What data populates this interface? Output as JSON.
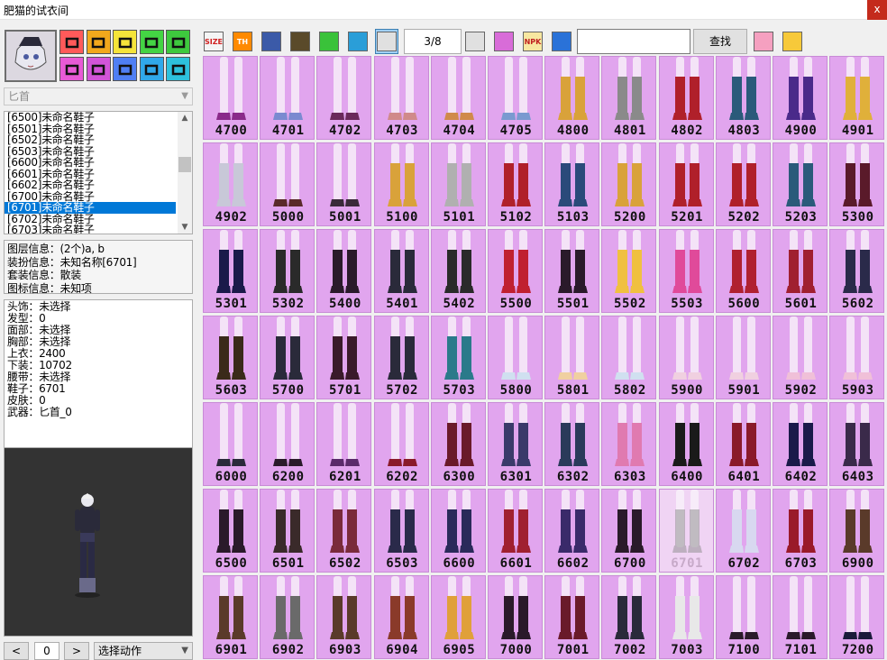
{
  "window": {
    "title": "肥猫的试衣间",
    "close_label": "x"
  },
  "category_buttons": [
    {
      "icon": "cat-ears-icon",
      "color": "#ff5a5a"
    },
    {
      "icon": "hair-icon",
      "color": "#f2a81c"
    },
    {
      "icon": "eyes-icon",
      "color": "#f5e43a"
    },
    {
      "icon": "wings-icon",
      "color": "#44d444"
    },
    {
      "icon": "crown-icon",
      "color": "#3ec93e"
    },
    {
      "icon": "gate-icon",
      "color": "#e85ad6"
    },
    {
      "icon": "belt-icon",
      "color": "#d254d8"
    },
    {
      "icon": "shoes-icon",
      "color": "#4f7ff4"
    },
    {
      "icon": "figure-icon",
      "color": "#30a8ea"
    },
    {
      "icon": "cross-icon",
      "color": "#2dc1dc"
    }
  ],
  "weapon_dropdown": {
    "value": "匕首"
  },
  "item_list": [
    {
      "label": "[6500]未命名鞋子",
      "selected": false
    },
    {
      "label": "[6501]未命名鞋子",
      "selected": false
    },
    {
      "label": "[6502]未命名鞋子",
      "selected": false
    },
    {
      "label": "[6503]未命名鞋子",
      "selected": false
    },
    {
      "label": "[6600]未命名鞋子",
      "selected": false
    },
    {
      "label": "[6601]未命名鞋子",
      "selected": false
    },
    {
      "label": "[6602]未命名鞋子",
      "selected": false
    },
    {
      "label": "[6700]未命名鞋子",
      "selected": false
    },
    {
      "label": "[6701]未命名鞋子",
      "selected": true
    },
    {
      "label": "[6702]未命名鞋子",
      "selected": false
    },
    {
      "label": "[6703]未命名鞋子",
      "selected": false
    }
  ],
  "info": {
    "layer": "图层信息：(2个)a, b",
    "costume": "装扮信息：未知名称[6701]",
    "set": "套装信息：散装",
    "icon": "图标信息：未知项"
  },
  "stats": [
    "头饰：未选择",
    "发型：0",
    "面部：未选择",
    "胸部：未选择",
    "上衣：2400",
    "下装：10702",
    "腰带：未选择",
    "鞋子：6701",
    "皮肤：0",
    "武器：匕首_0"
  ],
  "bottom": {
    "prev": "<",
    "index": "0",
    "next": ">",
    "action": "选择动作"
  },
  "toolbar": {
    "buttons": [
      {
        "icon": "size-icon",
        "text": "SIZE",
        "bg": "#f4f4f4",
        "fg": "#d02020"
      },
      {
        "icon": "th-icon",
        "text": "TH",
        "bg": "#ff8a00",
        "fg": "#ffffff"
      },
      {
        "icon": "book-icon",
        "text": "",
        "bg": "#3b5aa8",
        "fg": "#ffffff"
      },
      {
        "icon": "film-icon",
        "text": "",
        "bg": "#5a4a2a",
        "fg": "#ffffff"
      },
      {
        "icon": "shirt-icon",
        "text": "",
        "bg": "#3ac23a",
        "fg": "#ffffff"
      },
      {
        "icon": "refresh-icon",
        "text": "",
        "bg": "#2a9ed8",
        "fg": "#ffffff"
      },
      {
        "icon": "import-icon",
        "text": "",
        "bg": "#e0e0e0",
        "fg": "#c02020"
      },
      {
        "icon": "export-icon",
        "text": "",
        "bg": "#e0e0e0",
        "fg": "#c02020"
      },
      {
        "icon": "gift-icon",
        "text": "",
        "bg": "#d86cd8",
        "fg": "#ffffff"
      },
      {
        "icon": "npk-icon",
        "text": "NPK",
        "bg": "#f7e7a0",
        "fg": "#c02020"
      },
      {
        "icon": "globe-icon",
        "text": "",
        "bg": "#2a72d8",
        "fg": "#ffffff"
      },
      {
        "icon": "shuffle-icon",
        "text": "",
        "bg": "#f5a0c0",
        "fg": "#2050c0"
      },
      {
        "icon": "settings-icon",
        "text": "",
        "bg": "#f7c93a",
        "fg": "#555555"
      }
    ],
    "page": "3/8",
    "search_value": "",
    "search_label": "查找"
  },
  "grid_items": [
    {
      "id": "4700",
      "boot": "#ffffff00",
      "shoe": "#8a2a8a"
    },
    {
      "id": "4701",
      "boot": "#ffffff00",
      "shoe": "#7a8ad0"
    },
    {
      "id": "4702",
      "boot": "#ffffff00",
      "shoe": "#6a2a5a"
    },
    {
      "id": "4703",
      "boot": "#ffffff00",
      "shoe": "#d08a8a"
    },
    {
      "id": "4704",
      "boot": "#ffffff00",
      "shoe": "#d08a4a"
    },
    {
      "id": "4705",
      "boot": "#ffffff00",
      "shoe": "#7a9ad0"
    },
    {
      "id": "4800",
      "boot": "#d9a23a",
      "shoe": "#d9a23a"
    },
    {
      "id": "4801",
      "boot": "#8a8a8a",
      "shoe": "#8a8a8a"
    },
    {
      "id": "4802",
      "boot": "#b0202a",
      "shoe": "#b0202a"
    },
    {
      "id": "4803",
      "boot": "#2a5a7a",
      "shoe": "#2a5a7a"
    },
    {
      "id": "4900",
      "boot": "#4a2a8a",
      "shoe": "#4a2a8a"
    },
    {
      "id": "4901",
      "boot": "#e0b03a",
      "shoe": "#e0b03a"
    },
    {
      "id": "4902",
      "boot": "#c8c8d8",
      "shoe": "#c8c8d8"
    },
    {
      "id": "5000",
      "boot": "#ffffff00",
      "shoe": "#5a2a2a"
    },
    {
      "id": "5001",
      "boot": "#ffffff00",
      "shoe": "#3a2a3a"
    },
    {
      "id": "5100",
      "boot": "#d9a23a",
      "shoe": "#d9a23a"
    },
    {
      "id": "5101",
      "boot": "#b0b0b0",
      "shoe": "#b0b0b0"
    },
    {
      "id": "5102",
      "boot": "#b0202a",
      "shoe": "#b0202a"
    },
    {
      "id": "5103",
      "boot": "#2a4a7a",
      "shoe": "#2a4a7a"
    },
    {
      "id": "5200",
      "boot": "#d9a23a",
      "shoe": "#d9a23a"
    },
    {
      "id": "5201",
      "boot": "#b0202a",
      "shoe": "#b0202a"
    },
    {
      "id": "5202",
      "boot": "#b0202a",
      "shoe": "#b0202a"
    },
    {
      "id": "5203",
      "boot": "#2a5a7a",
      "shoe": "#2a5a7a"
    },
    {
      "id": "5300",
      "boot": "#5a1a2a",
      "shoe": "#5a1a2a"
    },
    {
      "id": "5301",
      "boot": "#1a1a4a",
      "shoe": "#1a1a4a"
    },
    {
      "id": "5302",
      "boot": "#2a2a2a",
      "shoe": "#2a2a2a"
    },
    {
      "id": "5400",
      "boot": "#2a1a2a",
      "shoe": "#2a1a2a"
    },
    {
      "id": "5401",
      "boot": "#2a2a3a",
      "shoe": "#2a2a3a"
    },
    {
      "id": "5402",
      "boot": "#2a2a2a",
      "shoe": "#2a2a2a"
    },
    {
      "id": "5500",
      "boot": "#c02030",
      "shoe": "#c02030"
    },
    {
      "id": "5501",
      "boot": "#2a1a2a",
      "shoe": "#2a1a2a"
    },
    {
      "id": "5502",
      "boot": "#f0c040",
      "shoe": "#f0c040"
    },
    {
      "id": "5503",
      "boot": "#e04a9a",
      "shoe": "#e04a9a"
    },
    {
      "id": "5600",
      "boot": "#b02030",
      "shoe": "#b02030"
    },
    {
      "id": "5601",
      "boot": "#a02030",
      "shoe": "#a02030"
    },
    {
      "id": "5602",
      "boot": "#2a2a4a",
      "shoe": "#2a2a4a"
    },
    {
      "id": "5603",
      "boot": "#3a2a1a",
      "shoe": "#3a2a1a"
    },
    {
      "id": "5700",
      "boot": "#2a2a3a",
      "shoe": "#2a2a3a"
    },
    {
      "id": "5701",
      "boot": "#3a1a2a",
      "shoe": "#3a1a2a"
    },
    {
      "id": "5702",
      "boot": "#2a2a3a",
      "shoe": "#2a2a3a"
    },
    {
      "id": "5703",
      "boot": "#2a7a8a",
      "shoe": "#2a7a8a"
    },
    {
      "id": "5800",
      "boot": "#ffffff00",
      "shoe": "#d0e0f0"
    },
    {
      "id": "5801",
      "boot": "#ffffff00",
      "shoe": "#f0d0a0"
    },
    {
      "id": "5802",
      "boot": "#ffffff00",
      "shoe": "#d0e0f0"
    },
    {
      "id": "5900",
      "boot": "#ffffff00",
      "shoe": "#f0d0e0"
    },
    {
      "id": "5901",
      "boot": "#ffffff00",
      "shoe": "#f0d0e0"
    },
    {
      "id": "5902",
      "boot": "#ffffff00",
      "shoe": "#f0c0d8"
    },
    {
      "id": "5903",
      "boot": "#ffffff00",
      "shoe": "#f0c0d8"
    },
    {
      "id": "6000",
      "boot": "#ffffff00",
      "shoe": "#2a2a3a"
    },
    {
      "id": "6200",
      "boot": "#ffffff00",
      "shoe": "#2a1a2a"
    },
    {
      "id": "6201",
      "boot": "#ffffff00",
      "shoe": "#5a2a6a"
    },
    {
      "id": "6202",
      "boot": "#ffffff00",
      "shoe": "#8a1a2a"
    },
    {
      "id": "6300",
      "boot": "#6a1a2a",
      "shoe": "#6a1a2a"
    },
    {
      "id": "6301",
      "boot": "#3a3a6a",
      "shoe": "#3a3a6a"
    },
    {
      "id": "6302",
      "boot": "#2a3a5a",
      "shoe": "#2a3a5a"
    },
    {
      "id": "6303",
      "boot": "#e07ab0",
      "shoe": "#e07ab0"
    },
    {
      "id": "6400",
      "boot": "#1a1a1a",
      "shoe": "#1a1a1a"
    },
    {
      "id": "6401",
      "boot": "#8a1a2a",
      "shoe": "#8a1a2a"
    },
    {
      "id": "6402",
      "boot": "#1a1a4a",
      "shoe": "#1a1a4a"
    },
    {
      "id": "6403",
      "boot": "#3a2a4a",
      "shoe": "#3a2a4a"
    },
    {
      "id": "6500",
      "boot": "#2a1a2a",
      "shoe": "#2a1a2a"
    },
    {
      "id": "6501",
      "boot": "#3a2a2a",
      "shoe": "#3a2a2a"
    },
    {
      "id": "6502",
      "boot": "#7a2a3a",
      "shoe": "#7a2a3a"
    },
    {
      "id": "6503",
      "boot": "#2a2a4a",
      "shoe": "#2a2a4a"
    },
    {
      "id": "6600",
      "boot": "#2a2a5a",
      "shoe": "#2a2a5a"
    },
    {
      "id": "6601",
      "boot": "#a02030",
      "shoe": "#a02030"
    },
    {
      "id": "6602",
      "boot": "#3a2a6a",
      "shoe": "#3a2a6a"
    },
    {
      "id": "6700",
      "boot": "#2a1a2a",
      "shoe": "#2a1a2a"
    },
    {
      "id": "6701",
      "boot": "#8a8a8a",
      "shoe": "#8a8a8a",
      "selected": true
    },
    {
      "id": "6702",
      "boot": "#d8d8f0",
      "shoe": "#d8d8f0"
    },
    {
      "id": "6703",
      "boot": "#9a1a2a",
      "shoe": "#9a1a2a"
    },
    {
      "id": "6900",
      "boot": "#5a3a2a",
      "shoe": "#5a3a2a"
    },
    {
      "id": "6901",
      "boot": "#5a3a2a",
      "shoe": "#5a3a2a"
    },
    {
      "id": "6902",
      "boot": "#6a6a6a",
      "shoe": "#6a6a6a"
    },
    {
      "id": "6903",
      "boot": "#5a3a2a",
      "shoe": "#5a3a2a"
    },
    {
      "id": "6904",
      "boot": "#8a3a2a",
      "shoe": "#8a3a2a"
    },
    {
      "id": "6905",
      "boot": "#e0a03a",
      "shoe": "#e0a03a"
    },
    {
      "id": "7000",
      "boot": "#2a1a2a",
      "shoe": "#2a1a2a"
    },
    {
      "id": "7001",
      "boot": "#6a1a2a",
      "shoe": "#6a1a2a"
    },
    {
      "id": "7002",
      "boot": "#2a2a3a",
      "shoe": "#2a2a3a"
    },
    {
      "id": "7003",
      "boot": "#e8e8e8",
      "shoe": "#e8e8e8"
    },
    {
      "id": "7100",
      "boot": "#ffffff00",
      "shoe": "#2a1a2a"
    },
    {
      "id": "7101",
      "boot": "#ffffff00",
      "shoe": "#2a1a2a"
    },
    {
      "id": "7200",
      "boot": "#ffffff00",
      "shoe": "#1a1a3a"
    }
  ]
}
